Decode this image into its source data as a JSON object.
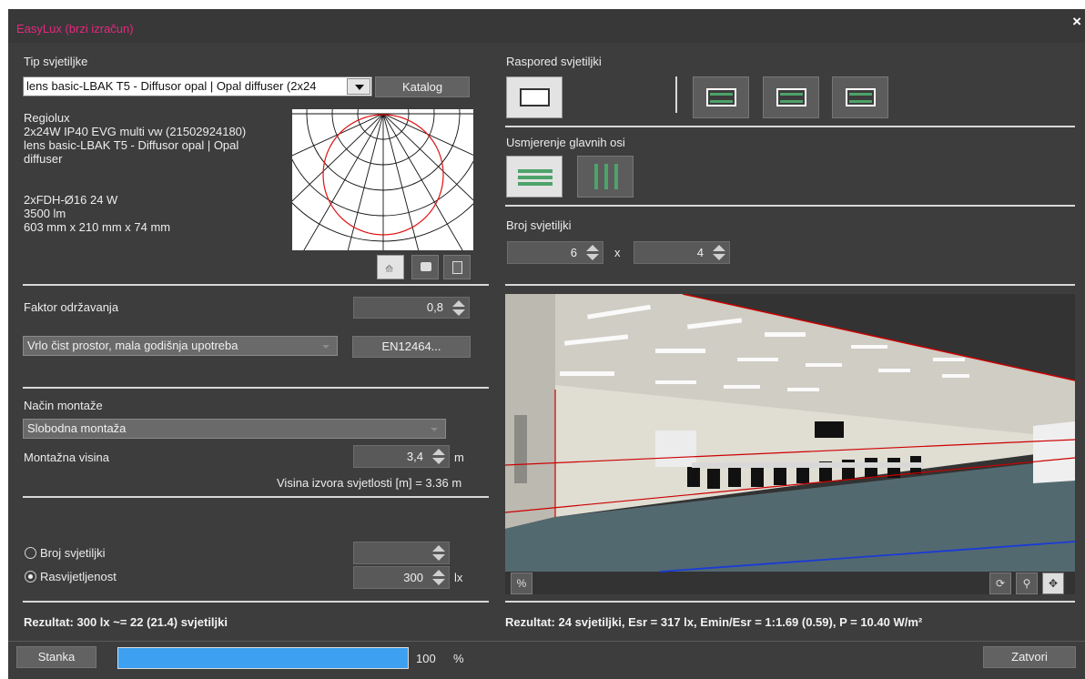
{
  "window": {
    "title": "EasyLux (brzi izračun)",
    "close": "×"
  },
  "left": {
    "lamp_type_label": "Tip svjetiljke",
    "lamp_select_value": "lens basic-LBAK T5 - Diffusor opal | Opal diffuser (2x24",
    "catalog_button": "Katalog",
    "lamp_info": {
      "line1": "Regiolux",
      "line2": "2x24W IP40 EVG multi vw (21502924180)",
      "line3": "lens basic-LBAK T5 - Diffusor opal | Opal",
      "line4": "diffuser",
      "line5": "2xFDH-Ø16 24 W",
      "line6": "3500 lm",
      "line7": "603 mm x 210 mm x 74 mm"
    },
    "maintenance_label": "Faktor održavanja",
    "maintenance_value": "0,8",
    "maintenance_select": "Vrlo čist prostor, mala godišnja upotreba",
    "en_button": "EN12464...",
    "mounting_label": "Način montaže",
    "mounting_select": "Slobodna montaža",
    "mount_height_label": "Montažna visina",
    "mount_height_value": "3,4",
    "mount_height_unit": "m",
    "source_height_text": "Visina izvora svjetlosti [m] = 3.36 m",
    "count_radio_label": "Broj svjetiljki",
    "count_value": "",
    "illum_radio_label": "Rasvijetljenost",
    "illum_value": "300",
    "illum_unit": "lx",
    "result": "Rezultat: 300 lx ~= 22 (21.4) svjetiljki"
  },
  "right": {
    "layout_label": "Raspored svjetiljki",
    "axis_label": "Usmjerenje glavnih osi",
    "count_label": "Broj svjetiljki",
    "count_x": "6",
    "count_times": "x",
    "count_y": "4",
    "result": "Rezultat: 24 svjetiljki, Esr = 317 lx, Emin/Esr = 1:1.69 (0.59), P = 10.40 W/m²"
  },
  "footer": {
    "pause_button": "Stanka",
    "progress": 100,
    "progress_value": "100",
    "progress_unit": "%",
    "close_button": "Zatvori"
  },
  "colors": {
    "title": "#e8277e",
    "progress": "#3da0f0",
    "luminaire": "#4ea36a"
  }
}
